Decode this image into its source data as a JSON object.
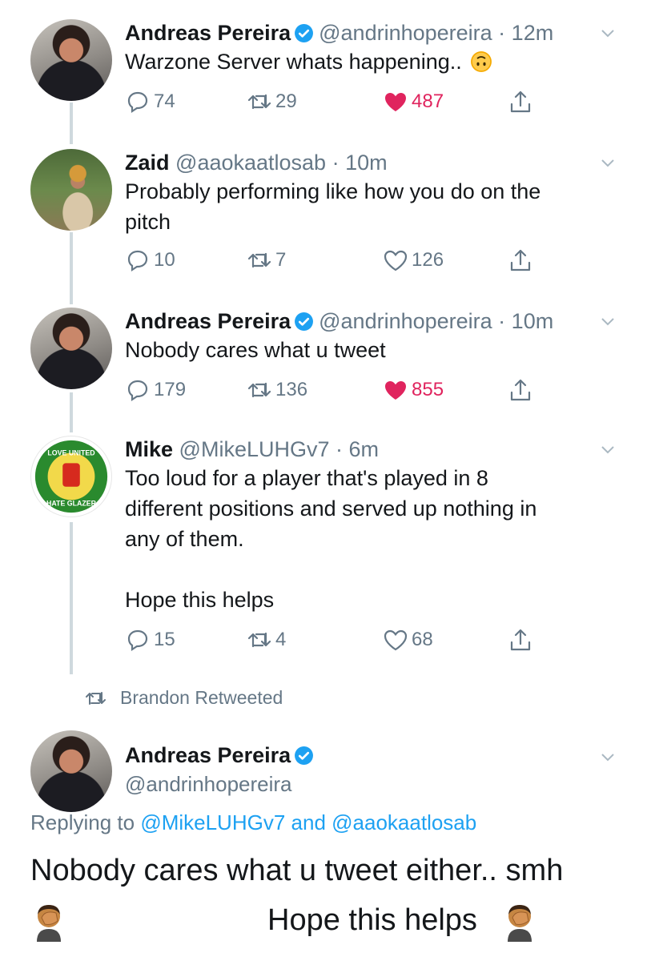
{
  "tweets": [
    {
      "name": "Andreas Pereira",
      "verified": true,
      "handle": "@andrinhopereira",
      "time": "12m",
      "text": "Warzone Server whats happening..",
      "emoji": "upside-down-face-emoji",
      "replies": "74",
      "retweets": "29",
      "likes": "487",
      "liked": true
    },
    {
      "name": "Zaid",
      "verified": false,
      "handle": "@aaokaatlosab",
      "time": "10m",
      "text_lines": [
        "Probably performing like how you do on the",
        "pitch"
      ],
      "replies": "10",
      "retweets": "7",
      "likes": "126",
      "liked": false
    },
    {
      "name": "Andreas Pereira",
      "verified": true,
      "handle": "@andrinhopereira",
      "time": "10m",
      "text": "Nobody cares what u tweet",
      "replies": "179",
      "retweets": "136",
      "likes": "855",
      "liked": true
    },
    {
      "name": "Mike",
      "verified": false,
      "handle": "@MikeLUHGv7",
      "time": "6m",
      "text_lines": [
        "Too loud for a player that's played in 8",
        "different positions and served up nothing in",
        "any of them.",
        "",
        "Hope this helps"
      ],
      "replies": "15",
      "retweets": "4",
      "likes": "68",
      "liked": false,
      "avatar_text": [
        "LOVE UNITED",
        "HATE GLAZER"
      ]
    }
  ],
  "retweet_context": "Brandon Retweeted",
  "main_tweet": {
    "name": "Andreas Pereira",
    "verified": true,
    "handle": "@andrinhopereira",
    "replying_prefix": "Replying to",
    "replying_to_1": "@MikeLUHGv7",
    "replying_and": "and",
    "replying_to_2": "@aaokaatlosab",
    "text_line1": "Nobody cares what u tweet either.. smh",
    "text_line2": "Hope this helps",
    "emoji": "man-facepalming-emoji"
  },
  "colors": {
    "text": "#14171a",
    "secondary": "#657786",
    "link": "#1da1f2",
    "like": "#e0245e",
    "thread": "#cfd9de"
  }
}
